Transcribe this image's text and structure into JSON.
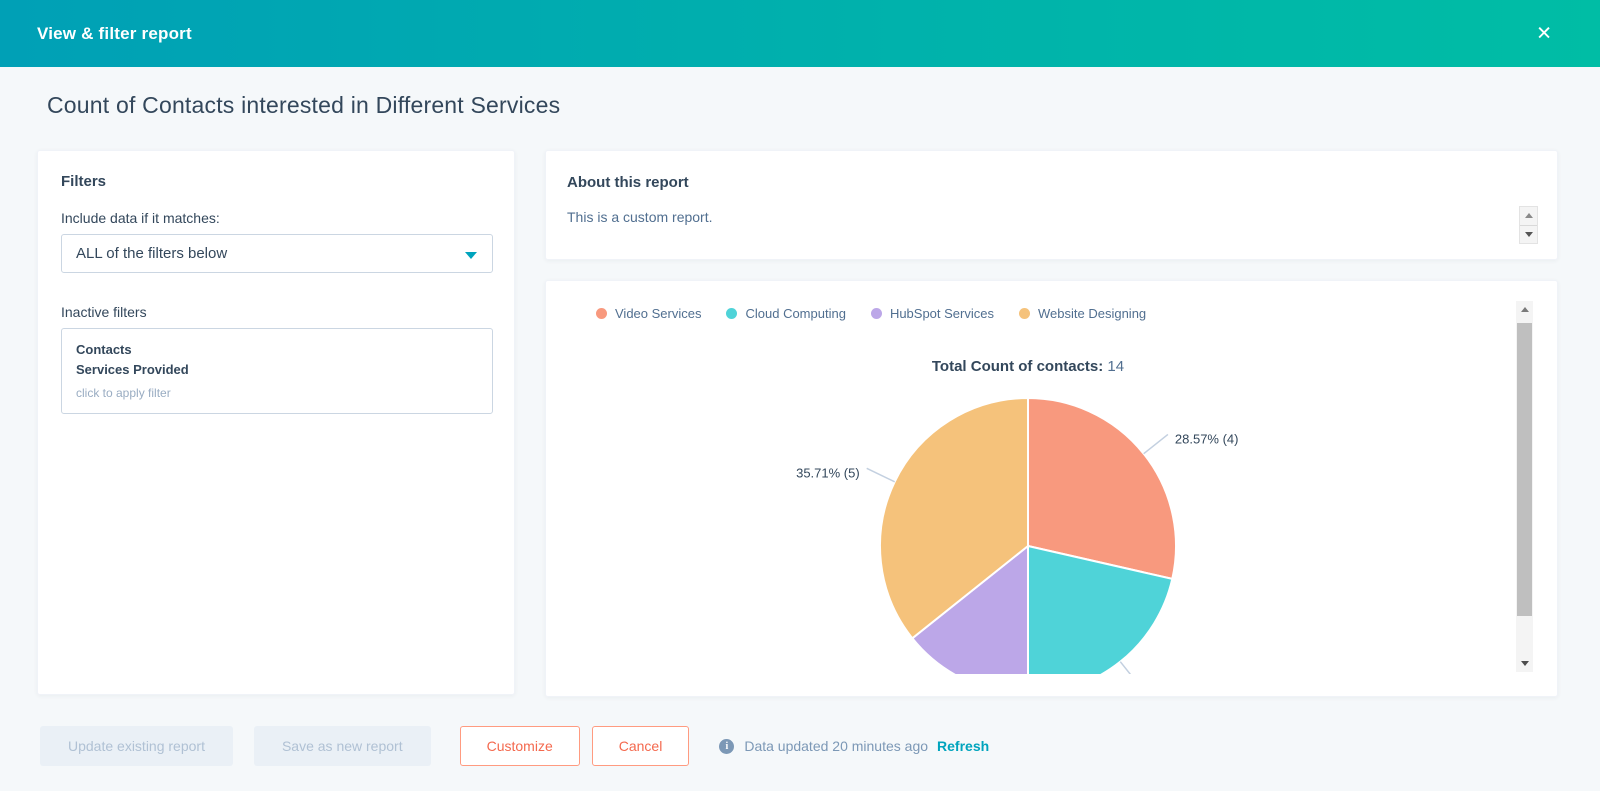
{
  "header": {
    "title": "View & filter report",
    "close_glyph": "✕"
  },
  "page": {
    "title": "Count of Contacts interested in Different Services"
  },
  "filters_panel": {
    "heading": "Filters",
    "match_label": "Include data if it matches:",
    "match_value": "ALL of the filters below",
    "inactive_heading": "Inactive filters",
    "inactive_filter": {
      "group": "Contacts",
      "property": "Services Provided",
      "hint": "click to apply filter"
    }
  },
  "about_panel": {
    "heading": "About this report",
    "description": "This is a custom report."
  },
  "chart_data": {
    "type": "pie",
    "title": "Total Count of contacts: 14",
    "total_label": "Total Count of contacts:",
    "total_value": "14",
    "legend_position": "top",
    "start_angle": "top",
    "direction": "clockwise",
    "series": [
      {
        "name": "Video Services",
        "value": 4,
        "percent": 28.57,
        "callout": "28.57% (4)",
        "color": "#f8997e"
      },
      {
        "name": "Cloud Computing",
        "value": 3,
        "percent": 21.43,
        "callout": "",
        "connector": true,
        "color": "#4fd3d8"
      },
      {
        "name": "HubSpot Services",
        "value": 2,
        "percent": 14.29,
        "color": "#bca7e8"
      },
      {
        "name": "Website Designing",
        "value": 5,
        "percent": 35.71,
        "callout": "35.71% (5)",
        "color": "#f5c27b"
      }
    ]
  },
  "footer": {
    "update_button": "Update existing report",
    "save_button": "Save as new report",
    "customize_button": "Customize",
    "cancel_button": "Cancel",
    "status": "Data updated 20 minutes ago",
    "refresh_link": "Refresh"
  },
  "colors": {
    "header_gradient_start": "#00a0b6",
    "header_gradient_end": "#00bda5",
    "accent_teal": "#00a4bd",
    "accent_orange": "#ff7a59",
    "background": "#f5f8fa",
    "text_primary": "#33475b",
    "text_secondary": "#516f90",
    "text_muted": "#99acc2"
  }
}
